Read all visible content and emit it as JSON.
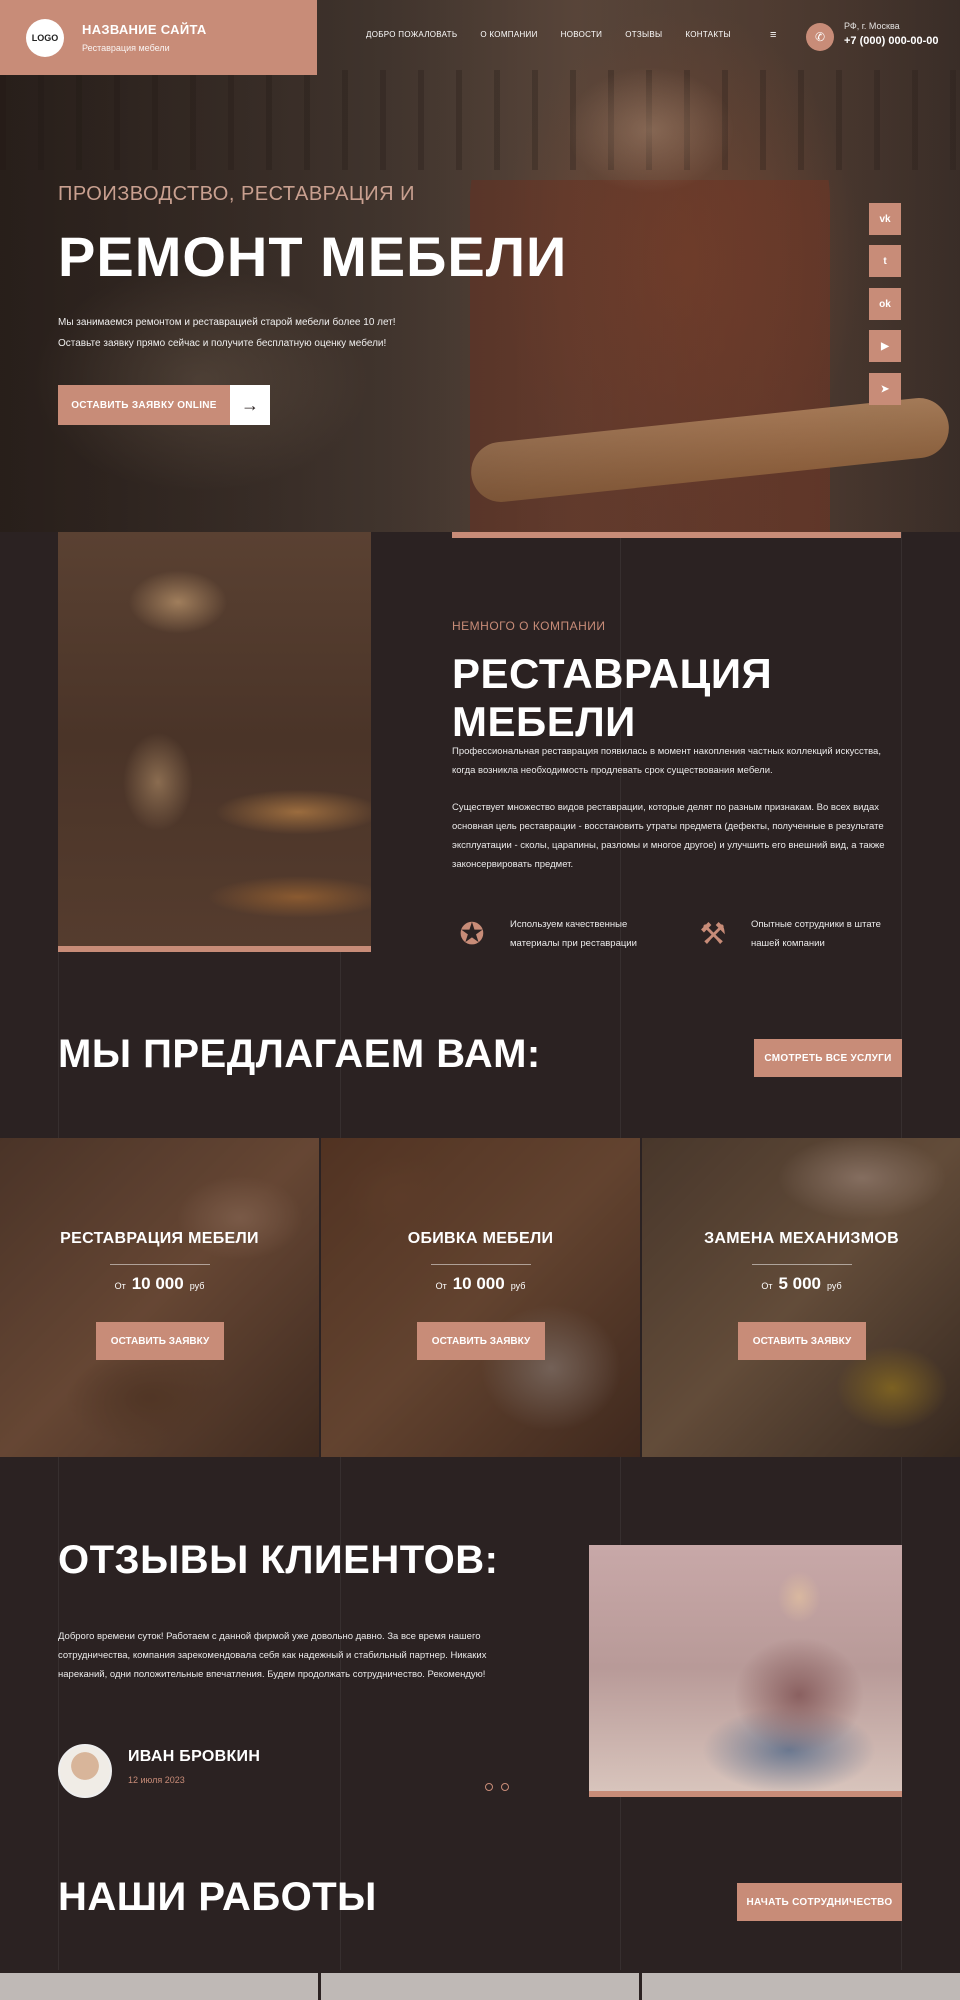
{
  "header": {
    "logo": "LOGO",
    "site_name": "НАЗВАНИЕ САЙТА",
    "site_tagline": "Реставрация мебели",
    "nav": [
      "ДОБРО ПОЖАЛОВАТЬ",
      "О КОМПАНИИ",
      "НОВОСТИ",
      "ОТЗЫВЫ",
      "КОНТАКТЫ"
    ],
    "city": "РФ, г. Москва",
    "phone": "+7 (000) 000-00-00"
  },
  "hero": {
    "subtitle": "ПРОИЗВОДСТВО, РЕСТАВРАЦИЯ И",
    "title": "РЕМОНТ МЕБЕЛИ",
    "text_line1": "Мы занимаемся ремонтом и реставрацией старой мебели более 10 лет!",
    "text_line2": "Оставьте заявку прямо сейчас и получите бесплатную оценку мебели!",
    "button": "ОСТАВИТЬ ЗАЯВКУ ONLINE",
    "social": [
      {
        "icon": "vk-icon",
        "glyph": "vk"
      },
      {
        "icon": "twitter-icon",
        "glyph": "t"
      },
      {
        "icon": "odnoklassniki-icon",
        "glyph": "ok"
      },
      {
        "icon": "youtube-icon",
        "glyph": "▶"
      },
      {
        "icon": "telegram-icon",
        "glyph": "➤"
      }
    ]
  },
  "about": {
    "kicker": "НЕМНОГО О КОМПАНИИ",
    "title": "РЕСТАВРАЦИЯ МЕБЕЛИ",
    "p1": "Профессиональная реставрация появилась в момент накопления частных коллекций искусства, когда возникла необходимость продлевать срок существования мебели.",
    "p2": "Существует множество видов реставрации, которые делят по разным признакам. Во всех видах основная цель реставрации - восстановить утраты предмета (дефекты, полученные в результате эксплуатации - сколы, царапины, разломы и многое другое) и улучшить его внешний вид, а также законсервировать предмет.",
    "feature1": "Используем качественные материалы при реставрации",
    "feature2": "Опытные сотрудники в штате нашей компании"
  },
  "services": {
    "title": "МЫ ПРЕДЛАГАЕМ ВАМ:",
    "all_button": "СМОТРЕТЬ ВСЕ УСЛУГИ",
    "items": [
      {
        "name": "РЕСТАВРАЦИЯ МЕБЕЛИ",
        "from": "От",
        "price": "10 000",
        "currency": "руб",
        "button": "ОСТАВИТЬ ЗАЯВКУ"
      },
      {
        "name": "ОБИВКА МЕБЕЛИ",
        "from": "От",
        "price": "10 000",
        "currency": "руб",
        "button": "ОСТАВИТЬ ЗАЯВКУ"
      },
      {
        "name": "ЗАМЕНА МЕХАНИЗМОВ",
        "from": "От",
        "price": "5 000",
        "currency": "руб",
        "button": "ОСТАВИТЬ ЗАЯВКУ"
      }
    ]
  },
  "reviews": {
    "title": "ОТЗЫВЫ КЛИЕНТОВ:",
    "text": "Доброго времени суток! Работаем с данной фирмой уже довольно давно. За все время нашего сотрудничества, компания зарекомендовала себя как надежный и стабильный партнер. Никаких нареканий, одни положительные впечатления. Будем продолжать сотрудничество. Рекомендую!",
    "name": "ИВАН БРОВКИН",
    "date": "12 июля 2023"
  },
  "works": {
    "title": "НАШИ РАБОТЫ",
    "button": "НАЧАТЬ СОТРУДНИЧЕСТВО"
  },
  "colors": {
    "accent": "#c88c78",
    "background": "#2b2222"
  }
}
